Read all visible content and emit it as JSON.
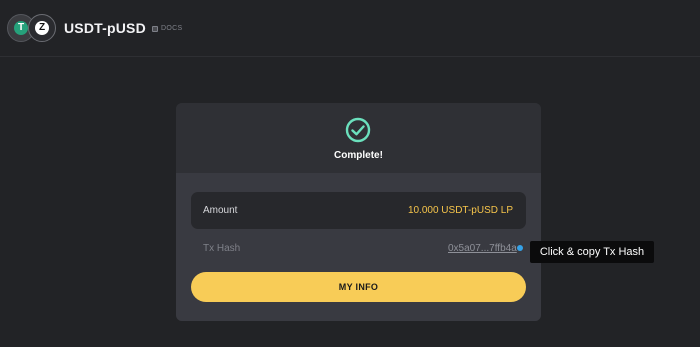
{
  "header": {
    "pair_name": "USDT-pUSD",
    "token_a_glyph": "T",
    "token_b_glyph": "Z",
    "docs_label": "DOCS"
  },
  "card": {
    "status_label": "Complete!",
    "amount_label": "Amount",
    "amount_value": "10.000 USDT-pUSD LP",
    "tx_label": "Tx Hash",
    "tx_hash": "0x5a07...7ffb4a",
    "button_label": "MY INFO"
  },
  "tooltip": {
    "text": "Click & copy Tx Hash"
  },
  "colors": {
    "accent_yellow": "#f8cc57",
    "success_green": "#6be0bd",
    "link_blue": "#35a2e8"
  },
  "icons": {
    "status": "check-circle-icon",
    "docs": "docs-icon",
    "copy": "copy-indicator-icon"
  }
}
